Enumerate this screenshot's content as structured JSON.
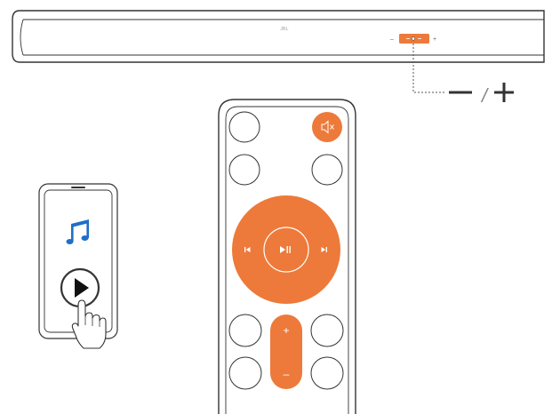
{
  "soundbar": {
    "brand": "JBL",
    "panel_minus": "–",
    "panel_plus": "+"
  },
  "volume_callout": {
    "minus": "–",
    "separator": "/",
    "plus": "+"
  },
  "remote": {
    "vol_plus": "+",
    "vol_minus": "–"
  },
  "colors": {
    "accent": "#ed7a3a",
    "stroke": "#333333",
    "note": "#1e6fc8"
  },
  "icons": [
    "mute-icon",
    "previous-track-icon",
    "play-pause-icon",
    "next-track-icon",
    "music-note-icon",
    "play-icon",
    "pointing-hand-icon"
  ]
}
